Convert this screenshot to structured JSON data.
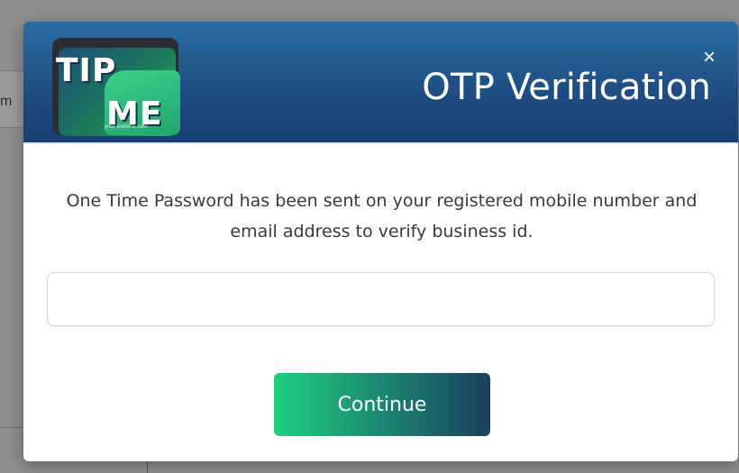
{
  "background": {
    "partial_label": "m"
  },
  "modal": {
    "title": "OTP Verification",
    "close_label": "×",
    "logo": {
      "line1": "TIP",
      "line2": "ME",
      "tagline": "your wallet is safe"
    },
    "message": "One Time Password has been sent on your registered mobile number and email address to verify business id.",
    "otp_input": {
      "value": "",
      "placeholder": ""
    },
    "continue_label": "Continue"
  },
  "colors": {
    "header_top": "#2b6ea3",
    "header_bottom": "#183f73",
    "button_start": "#1fcf7f",
    "button_end": "#1b3f5e",
    "overlay": "#8f8f8f"
  },
  "icons": {
    "close": "close-icon"
  }
}
